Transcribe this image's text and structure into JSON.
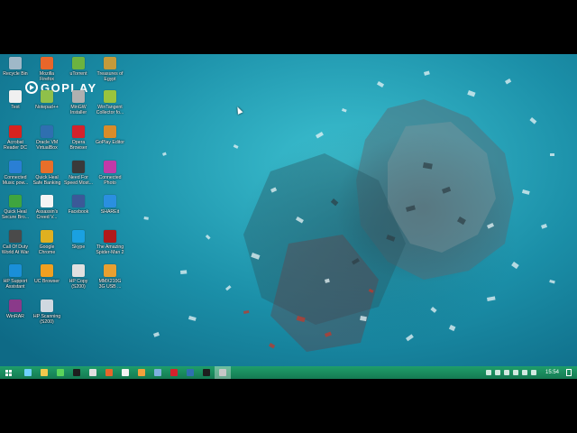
{
  "brand": {
    "logo_text": "GOPLAY"
  },
  "desktop_icons": [
    {
      "label": "Recycle Bin",
      "icon": "recycle-bin-icon",
      "color": "#9fb8c8"
    },
    {
      "label": "Mozilla\nFirefox",
      "icon": "firefox-icon",
      "color": "#e8662a"
    },
    {
      "label": "uTorrent",
      "icon": "utorrent-icon",
      "color": "#6cb33f"
    },
    {
      "label": "Treasures of\nEgypt",
      "icon": "treasures-icon",
      "color": "#c49a3a"
    },
    {
      "label": "Text",
      "icon": "text-file-icon",
      "color": "#f0f0f0"
    },
    {
      "label": "Notepad++",
      "icon": "notepadpp-icon",
      "color": "#8fc04a"
    },
    {
      "label": "MinGW\nInstaller",
      "icon": "mingw-icon",
      "color": "#b0b0b0"
    },
    {
      "label": "WinTangent\nCollector fo...",
      "icon": "wintangent-icon",
      "color": "#9ac43c"
    },
    {
      "label": "Acrobat\nReader DC",
      "icon": "acrobat-icon",
      "color": "#d8231f"
    },
    {
      "label": "Oracle VM\nVirtualBox",
      "icon": "virtualbox-icon",
      "color": "#2f6fb0"
    },
    {
      "label": "Opera\nBrowser",
      "icon": "opera-icon",
      "color": "#d4222c"
    },
    {
      "label": "GoPlay Editor",
      "icon": "goplay-editor-icon",
      "color": "#d98c2a"
    },
    {
      "label": "Connected\nMusic pow...",
      "icon": "connected-music-icon",
      "color": "#2a7fd4"
    },
    {
      "label": "Quick Heal\nSafe Banking",
      "icon": "quickheal-banking-icon",
      "color": "#e86f2a"
    },
    {
      "label": "Need For\nSpeed Most...",
      "icon": "nfs-icon",
      "color": "#3a3a3a"
    },
    {
      "label": "Connected\nPhoto",
      "icon": "connected-photo-icon",
      "color": "#c23aa8"
    },
    {
      "label": "Quick Heal\nSecure Bro...",
      "icon": "quickheal-browser-icon",
      "color": "#3fa53f"
    },
    {
      "label": "Assassin's\nCreed V...",
      "icon": "assassins-creed-icon",
      "color": "#f4f4f4"
    },
    {
      "label": "Facebook",
      "icon": "facebook-icon",
      "color": "#3b5998"
    },
    {
      "label": "SHAREit",
      "icon": "shareit-icon",
      "color": "#2a8fe0"
    },
    {
      "label": "Call Of Duty\nWorld At War",
      "icon": "cod-icon",
      "color": "#4a4a4a"
    },
    {
      "label": "Google\nChrome",
      "icon": "chrome-icon",
      "color": "#e0b020"
    },
    {
      "label": "Skype",
      "icon": "skype-icon",
      "color": "#1aa1e1"
    },
    {
      "label": "The Amazing\nSpider-Man 2",
      "icon": "spiderman-icon",
      "color": "#b01a1a"
    },
    {
      "label": "HP Support\nAssistant",
      "icon": "hp-support-icon",
      "color": "#1a8fd8"
    },
    {
      "label": "UC Browser",
      "icon": "uc-browser-icon",
      "color": "#f0a020"
    },
    {
      "label": "HP Copy\n(S200)",
      "icon": "hp-copy-icon",
      "color": "#e0e0e0"
    },
    {
      "label": "MMX210G\n3G USB ...",
      "icon": "mmx-usb-icon",
      "color": "#e8a030"
    },
    {
      "label": "WinRAR",
      "icon": "winrar-icon",
      "color": "#8a3a8a"
    },
    {
      "label": "HP Scanning\n(S200)",
      "icon": "hp-scanning-icon",
      "color": "#d0d8e0"
    }
  ],
  "taskbar": {
    "start_icon": "windows-start-icon",
    "apps": [
      {
        "icon": "edge-icon",
        "color": "#6fd0ff"
      },
      {
        "icon": "file-explorer-icon",
        "color": "#f2c94c"
      },
      {
        "icon": "store-icon",
        "color": "#5bd45b"
      },
      {
        "icon": "media-player-icon",
        "color": "#1e1e1e"
      },
      {
        "icon": "hp-icon",
        "color": "#e0e0e0"
      },
      {
        "icon": "firefox-taskbar-icon",
        "color": "#e8662a"
      },
      {
        "icon": "photos-icon",
        "color": "#f4f4f4"
      },
      {
        "icon": "paint-icon",
        "color": "#f2a03c"
      },
      {
        "icon": "calculator-icon",
        "color": "#7fb0e0"
      },
      {
        "icon": "opera-taskbar-icon",
        "color": "#d4222c"
      },
      {
        "icon": "virtualbox-taskbar-icon",
        "color": "#2f6fb0"
      },
      {
        "icon": "terminal-icon",
        "color": "#1e1e1e"
      },
      {
        "icon": "recorder-icon",
        "color": "#c8c8c8"
      }
    ],
    "active_index": 12,
    "tray_icons": [
      "network-icon",
      "action-center-icon",
      "battery-icon",
      "wifi-icon",
      "volume-icon",
      "keyboard-icon"
    ],
    "clock": "15:54"
  }
}
